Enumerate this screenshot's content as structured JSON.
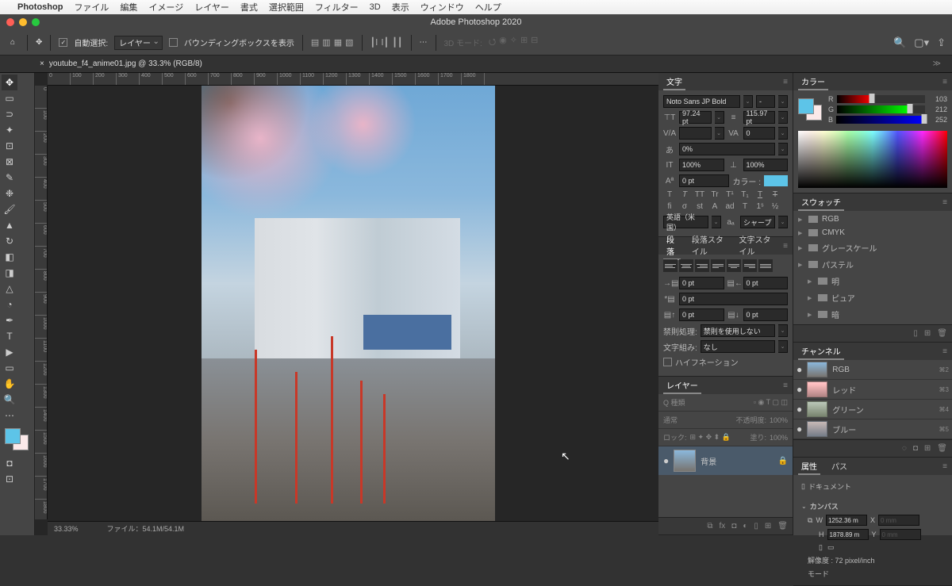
{
  "mac_menu": {
    "app": "Photoshop",
    "items": [
      "ファイル",
      "編集",
      "イメージ",
      "レイヤー",
      "書式",
      "選択範囲",
      "フィルター",
      "3D",
      "表示",
      "ウィンドウ",
      "ヘルプ"
    ]
  },
  "window_title": "Adobe Photoshop 2020",
  "options": {
    "auto_select": "自動選択:",
    "layer": "レイヤー",
    "show_bbox": "バウンディングボックスを表示",
    "mode3d": "3D モード:"
  },
  "doc_tab": "youtube_f4_anime01.jpg @ 33.3% (RGB/8)",
  "status": {
    "zoom": "33.33%",
    "file": "ファイル：54.1M/54.1M"
  },
  "ruler_h": [
    "0",
    "100",
    "200",
    "300",
    "400",
    "500",
    "600",
    "700",
    "800",
    "900",
    "1000",
    "1100",
    "1200",
    "1300",
    "1400",
    "1500",
    "1600",
    "1700",
    "1800"
  ],
  "ruler_v": [
    "0",
    "100",
    "200",
    "300",
    "400",
    "500",
    "600",
    "700",
    "800",
    "900",
    "1000",
    "1100",
    "1200",
    "1300",
    "1400",
    "1500",
    "1600",
    "1700",
    "1800"
  ],
  "character": {
    "title": "文字",
    "font": "Noto Sans JP Bold",
    "style": "-",
    "size": "97.24 pt",
    "leading": "115.97 pt",
    "va": "",
    "tracking": "0",
    "scale_v": "0%",
    "scale_h": "100%",
    "vscale": "100%",
    "baseline": "0 pt",
    "color_label": "カラー :",
    "lang": "英語（米国）",
    "aa": "シャープ"
  },
  "paragraph": {
    "tabs": [
      "段落",
      "段落スタイル",
      "文字スタイル"
    ],
    "indent_left": "0 pt",
    "indent_right": "0 pt",
    "indent_first": "0 pt",
    "space_before": "0 pt",
    "space_after": "0 pt",
    "kinsoku_label": "禁則処理:",
    "kinsoku": "禁則を使用しない",
    "mojikumi_label": "文字組み:",
    "mojikumi": "なし",
    "hyphen": "ハイフネーション"
  },
  "layers": {
    "title": "レイヤー",
    "kind": "Q 種類",
    "blend": "通常",
    "opacity_label": "不透明度:",
    "opacity": "100%",
    "lock_label": "ロック:",
    "fill_label": "塗り:",
    "fill": "100%",
    "bg": "背景"
  },
  "color": {
    "title": "カラー",
    "r": "103",
    "g": "212",
    "b": "252"
  },
  "swatches": {
    "title": "スウォッチ",
    "items": [
      "RGB",
      "CMYK",
      "グレースケール",
      "パステル",
      "明",
      "ピュア",
      "暗"
    ]
  },
  "channels": {
    "title": "チャンネル",
    "items": [
      {
        "name": "RGB",
        "key": "⌘2"
      },
      {
        "name": "レッド",
        "key": "⌘3"
      },
      {
        "name": "グリーン",
        "key": "⌘4"
      },
      {
        "name": "ブルー",
        "key": "⌘5"
      }
    ]
  },
  "properties": {
    "tabs": [
      "属性",
      "パス"
    ],
    "doc": "ドキュメント",
    "canvas": "カンバス",
    "w_label": "W",
    "w": "1252.36 m",
    "x_label": "X",
    "x": "0 mm",
    "h_label": "H",
    "h": "1878.89 m",
    "y_label": "Y",
    "y": "0 mm",
    "resolution": "解像度 : 72 pixel/inch",
    "mode": "モード"
  }
}
